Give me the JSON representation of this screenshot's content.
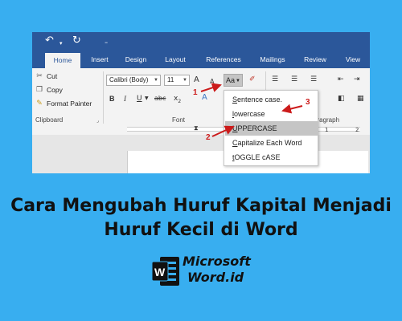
{
  "quick_access": {
    "undo_icon": "undo-icon",
    "redo_icon": "redo-icon",
    "customize_icon": "customize-qat-icon"
  },
  "tabs": [
    {
      "label": "Home",
      "active": true
    },
    {
      "label": "Insert"
    },
    {
      "label": "Design"
    },
    {
      "label": "Layout"
    },
    {
      "label": "References"
    },
    {
      "label": "Mailings"
    },
    {
      "label": "Review"
    },
    {
      "label": "View"
    }
  ],
  "clipboard": {
    "cut_label": "Cut",
    "copy_label": "Copy",
    "format_painter_label": "Format Painter",
    "group_label": "Clipboard"
  },
  "font": {
    "font_name": "Calibri (Body)",
    "font_size": "11",
    "grow_label": "A",
    "shrink_label": "A",
    "change_case_label": "Aa",
    "bold": "B",
    "italic": "I",
    "underline": "U",
    "strike": "abc",
    "subscript": "x",
    "subscript_mark": "2",
    "text_effects": "A",
    "group_label": "Font"
  },
  "paragraph": {
    "group_label": "aragraph"
  },
  "ruler": {
    "marks": [
      "1",
      "2"
    ]
  },
  "change_case_menu": {
    "items": [
      {
        "label": "Sentence case.",
        "accel": "S",
        "rest": "entence case."
      },
      {
        "label": "lowercase",
        "accel": "l",
        "rest": "owercase"
      },
      {
        "label": "UPPERCASE",
        "accel": "U",
        "rest": "PPERCASE",
        "highlighted": true
      },
      {
        "label": "Capitalize Each Word",
        "accel": "C",
        "rest": "apitalize Each Word"
      },
      {
        "label": "tOGGLE cASE",
        "accel": "t",
        "rest": "OGGLE cASE"
      }
    ]
  },
  "annotations": [
    {
      "number": "1"
    },
    {
      "number": "2"
    },
    {
      "number": "3"
    }
  ],
  "annotation_color": "#cc1b1b",
  "headline": {
    "line1": "Cara Mengubah Huruf Kapital Menjadi",
    "line2": "Huruf Kecil di Word"
  },
  "logo": {
    "line1": "Microsoft",
    "line2": "Word.id",
    "badge": "W"
  },
  "colors": {
    "background": "#38aef0",
    "word_blue": "#2b579a"
  }
}
